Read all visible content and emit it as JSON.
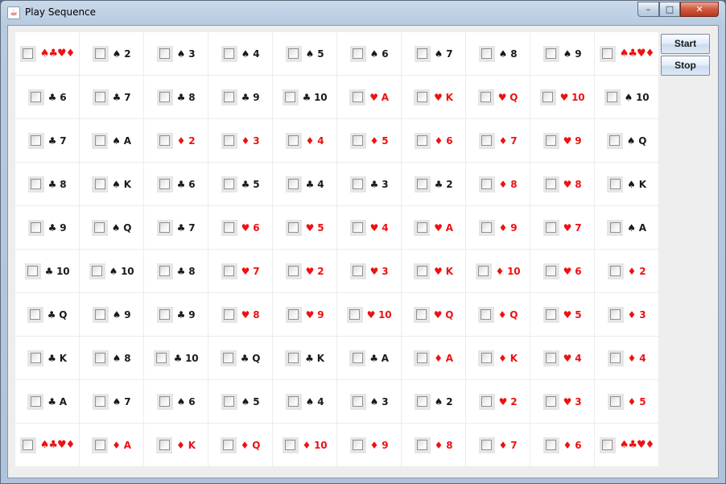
{
  "window": {
    "title": "Play Sequence",
    "app_icon": "java-cup-icon"
  },
  "window_controls": {
    "minimize": "–",
    "maximize": "□",
    "close": "✕"
  },
  "buttons": {
    "start": "Start",
    "stop": "Stop"
  },
  "colors": {
    "red_suit": "#ee1111",
    "black_suit": "#1a1a1a",
    "board_bg": "#ffffff"
  },
  "board": [
    [
      "JOKER",
      "♠2",
      "♠3",
      "♠4",
      "♠5",
      "♠6",
      "♠7",
      "♠8",
      "♠9",
      "JOKER"
    ],
    [
      "♣6",
      "♣7",
      "♣8",
      "♣9",
      "♣10",
      "♥A",
      "♥K",
      "♥Q",
      "♥10",
      "♠10"
    ],
    [
      "♣7",
      "♠A",
      "♦2",
      "♦3",
      "♦4",
      "♦5",
      "♦6",
      "♦7",
      "♥9",
      "♠Q"
    ],
    [
      "♣8",
      "♠K",
      "♣6",
      "♣5",
      "♣4",
      "♣3",
      "♣2",
      "♦8",
      "♥8",
      "♠K"
    ],
    [
      "♣9",
      "♠Q",
      "♣7",
      "♥6",
      "♥5",
      "♥4",
      "♥A",
      "♦9",
      "♥7",
      "♠A"
    ],
    [
      "♣10",
      "♠10",
      "♣8",
      "♥7",
      "♥2",
      "♥3",
      "♥K",
      "♦10",
      "♥6",
      "♦2"
    ],
    [
      "♣Q",
      "♠9",
      "♣9",
      "♥8",
      "♥9",
      "♥10",
      "♥Q",
      "♦Q",
      "♥5",
      "♦3"
    ],
    [
      "♣K",
      "♠8",
      "♣10",
      "♣Q",
      "♣K",
      "♣A",
      "♦A",
      "♦K",
      "♥4",
      "♦4"
    ],
    [
      "♣A",
      "♠7",
      "♠6",
      "♠5",
      "♠4",
      "♠3",
      "♠2",
      "♥2",
      "♥3",
      "♦5"
    ],
    [
      "JOKER",
      "♦A",
      "♦K",
      "♦Q",
      "♦10",
      "♦9",
      "♦8",
      "♦7",
      "♦6",
      "JOKER"
    ]
  ],
  "joker_label": [
    "♠",
    "♣",
    "♥",
    "♦"
  ]
}
